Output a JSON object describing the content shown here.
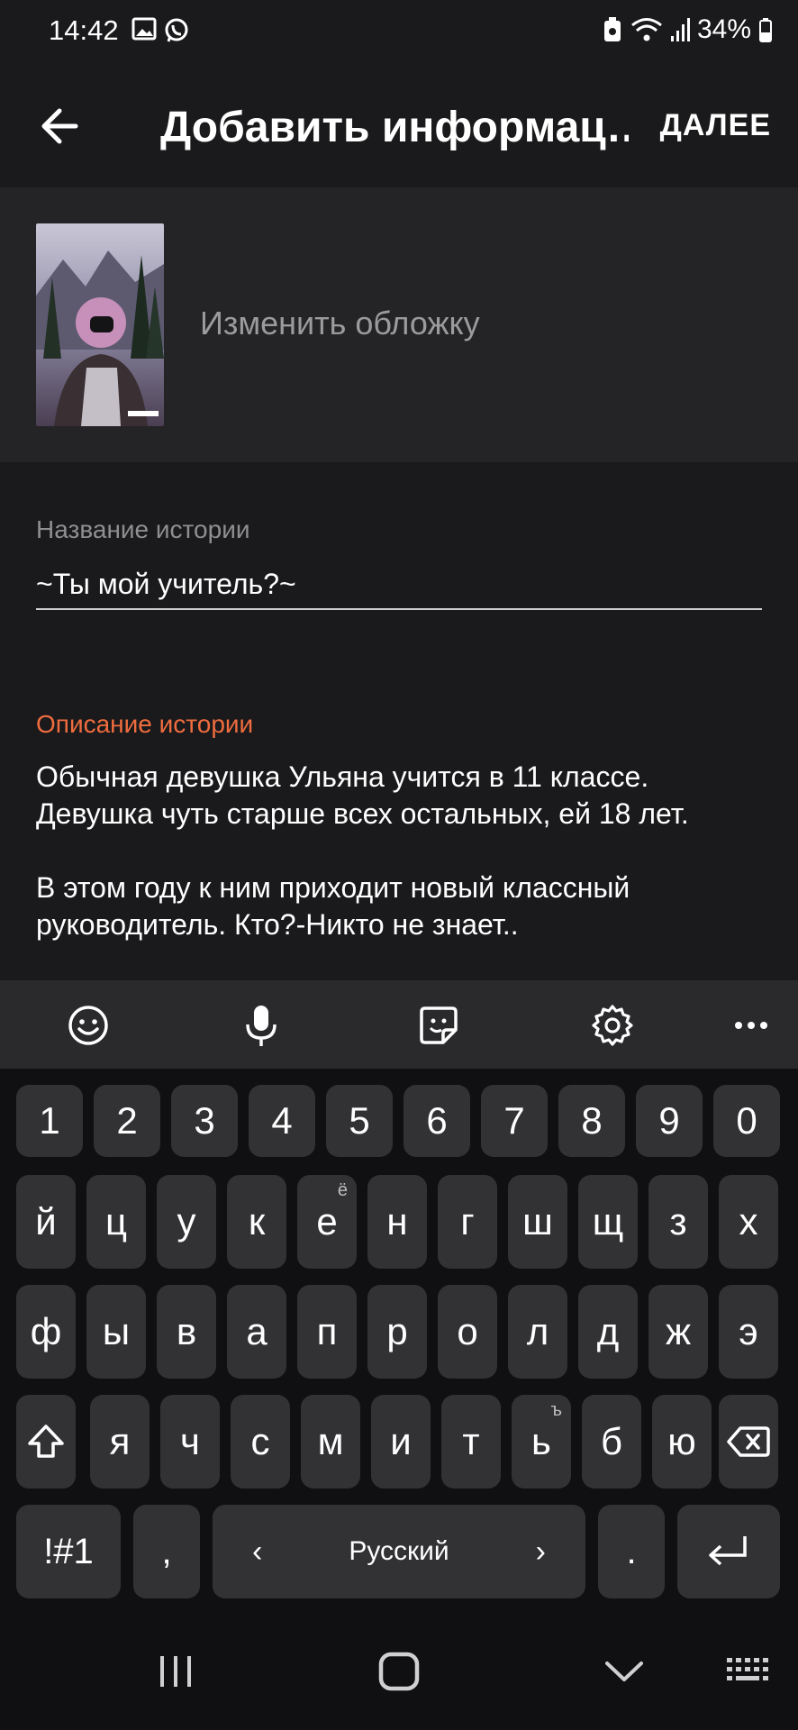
{
  "status": {
    "time": "14:42",
    "battery": "34%",
    "left_icons": [
      "gallery-icon",
      "whatsapp-icon"
    ],
    "right_icons": [
      "battery-saver-icon",
      "wifi-icon",
      "signal-icon",
      "battery-icon"
    ]
  },
  "appbar": {
    "title": "Добавить информац…",
    "next_label": "ДАЛЕЕ"
  },
  "cover": {
    "change_label": "Изменить обложку"
  },
  "story_title": {
    "label": "Название истории",
    "value": "~Ты мой учитель?~"
  },
  "story_description": {
    "label": "Описание истории",
    "lines": [
      "Обычная девушка Ульяна учится в 11 классе.",
      "Девушка чуть старше всех остальных, ей 18 лет.",
      "",
      "В этом году к ним приходит новый классный",
      "руководитель. Кто?-Никто не знает.."
    ]
  },
  "keyboard": {
    "toolbar": [
      "emoji-icon",
      "microphone-icon",
      "sticker-icon",
      "settings-icon",
      "more-icon"
    ],
    "row_numbers": [
      "1",
      "2",
      "3",
      "4",
      "5",
      "6",
      "7",
      "8",
      "9",
      "0"
    ],
    "row1": [
      "й",
      "ц",
      "у",
      "к",
      "е",
      "н",
      "г",
      "ш",
      "щ",
      "з",
      "х"
    ],
    "row1_hint": "ё",
    "row2": [
      "ф",
      "ы",
      "в",
      "а",
      "п",
      "р",
      "о",
      "л",
      "д",
      "ж",
      "э"
    ],
    "row3": [
      "я",
      "ч",
      "с",
      "м",
      "и",
      "т",
      "ь",
      "б",
      "ю"
    ],
    "row3_hint": "ъ",
    "symbols_label": "!#1",
    "comma_label": ",",
    "space_label": "Русский",
    "space_left_arrow": "‹",
    "space_right_arrow": "›",
    "period_label": "."
  },
  "colors": {
    "background": "#1a191b",
    "panel": "#242326",
    "accent": "#ef6d3f",
    "key": "#323235",
    "keyboard_bg": "#101012"
  }
}
